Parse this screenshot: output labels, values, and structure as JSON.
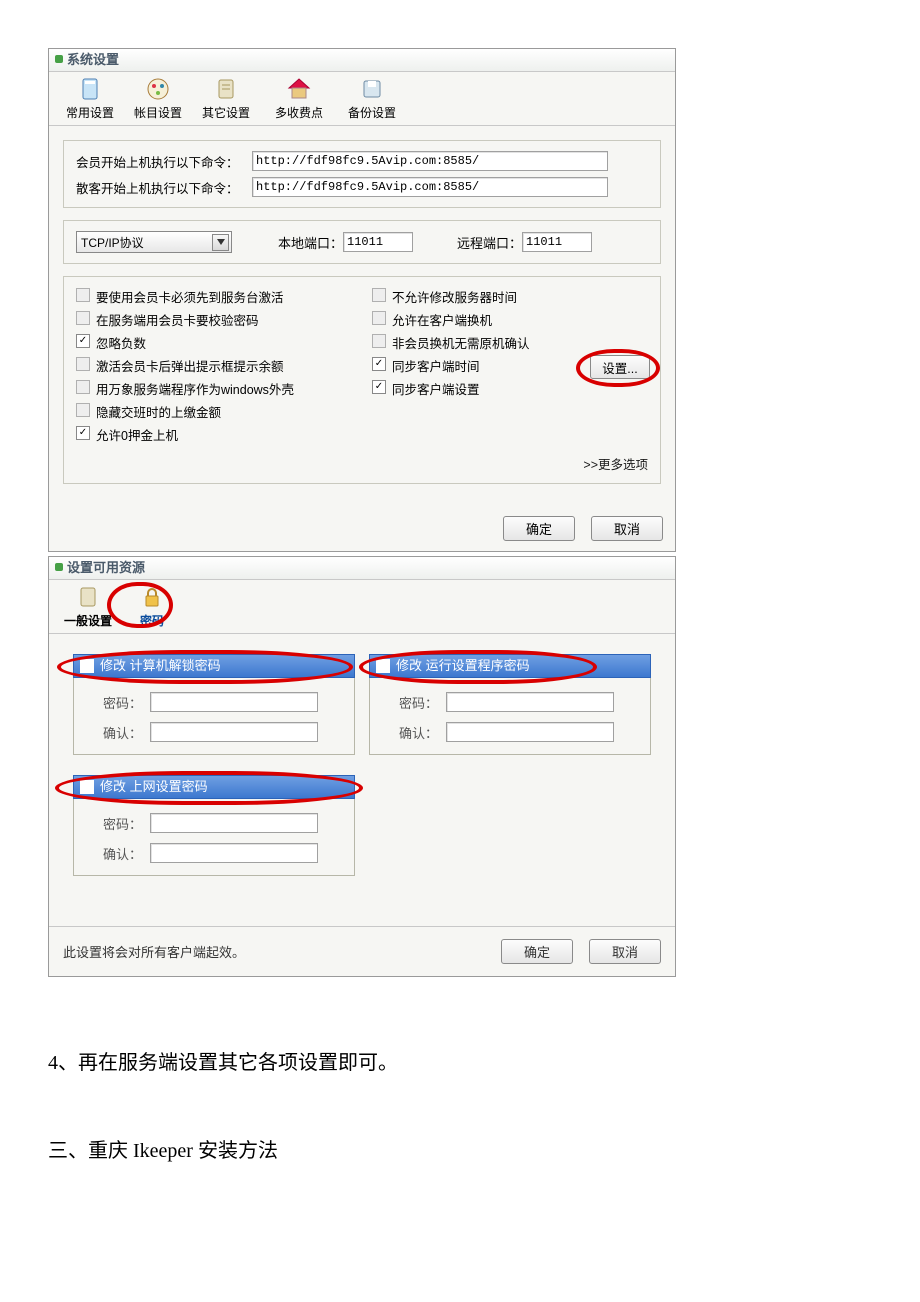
{
  "win1": {
    "title": "系统设置",
    "tabs": [
      "常用设置",
      "帐目设置",
      "其它设置",
      "多收费点",
      "备份设置"
    ],
    "frame1": {
      "row1_label": "会员开始上机执行以下命令：",
      "row1_value": "http://fdf98fc9.5Avip.com:8585/",
      "row2_label": "散客开始上机执行以下命令：",
      "row2_value": "http://fdf98fc9.5Avip.com:8585/"
    },
    "frame2": {
      "protocol": "TCP/IP协议",
      "local_port_label": "本地端口：",
      "local_port": "11011",
      "remote_port_label": "远程端口：",
      "remote_port": "11011"
    },
    "checks_left": [
      {
        "text": "要使用会员卡必须先到服务台激活",
        "checked": false,
        "enabled": false
      },
      {
        "text": "在服务端用会员卡要校验密码",
        "checked": false,
        "enabled": false
      },
      {
        "text": "忽略负数",
        "checked": true,
        "enabled": true
      },
      {
        "text": "激活会员卡后弹出提示框提示余额",
        "checked": false,
        "enabled": false
      },
      {
        "text": "用万象服务端程序作为windows外壳",
        "checked": false,
        "enabled": false
      },
      {
        "text": "隐藏交班时的上缴金额",
        "checked": false,
        "enabled": false
      },
      {
        "text": "允许0押金上机",
        "checked": true,
        "enabled": true
      }
    ],
    "checks_right": [
      {
        "text": "不允许修改服务器时间",
        "checked": false,
        "enabled": false
      },
      {
        "text": "允许在客户端换机",
        "checked": false,
        "enabled": false
      },
      {
        "text": "非会员换机无需原机确认",
        "checked": false,
        "enabled": false
      },
      {
        "text": "同步客户端时间",
        "checked": true,
        "enabled": true
      },
      {
        "text": "同步客户端设置",
        "checked": true,
        "enabled": true
      }
    ],
    "settings_btn": "设置...",
    "more_link": ">>更多选项",
    "ok": "确定",
    "cancel": "取消"
  },
  "win2": {
    "title": "设置可用资源",
    "tabs": [
      "一般设置",
      "密码"
    ],
    "groups": [
      {
        "title": "修改 计算机解锁密码"
      },
      {
        "title": "修改 运行设置程序密码"
      },
      {
        "title": "修改  上网设置密码"
      }
    ],
    "pw_label": "密码：",
    "confirm_label": "确认：",
    "footer_note": "此设置将会对所有客户端起效。",
    "ok": "确定",
    "cancel": "取消"
  },
  "body": {
    "line1": "4、再在服务端设置其它各项设置即可。",
    "line2": "三、重庆 Ikeeper 安装方法"
  }
}
